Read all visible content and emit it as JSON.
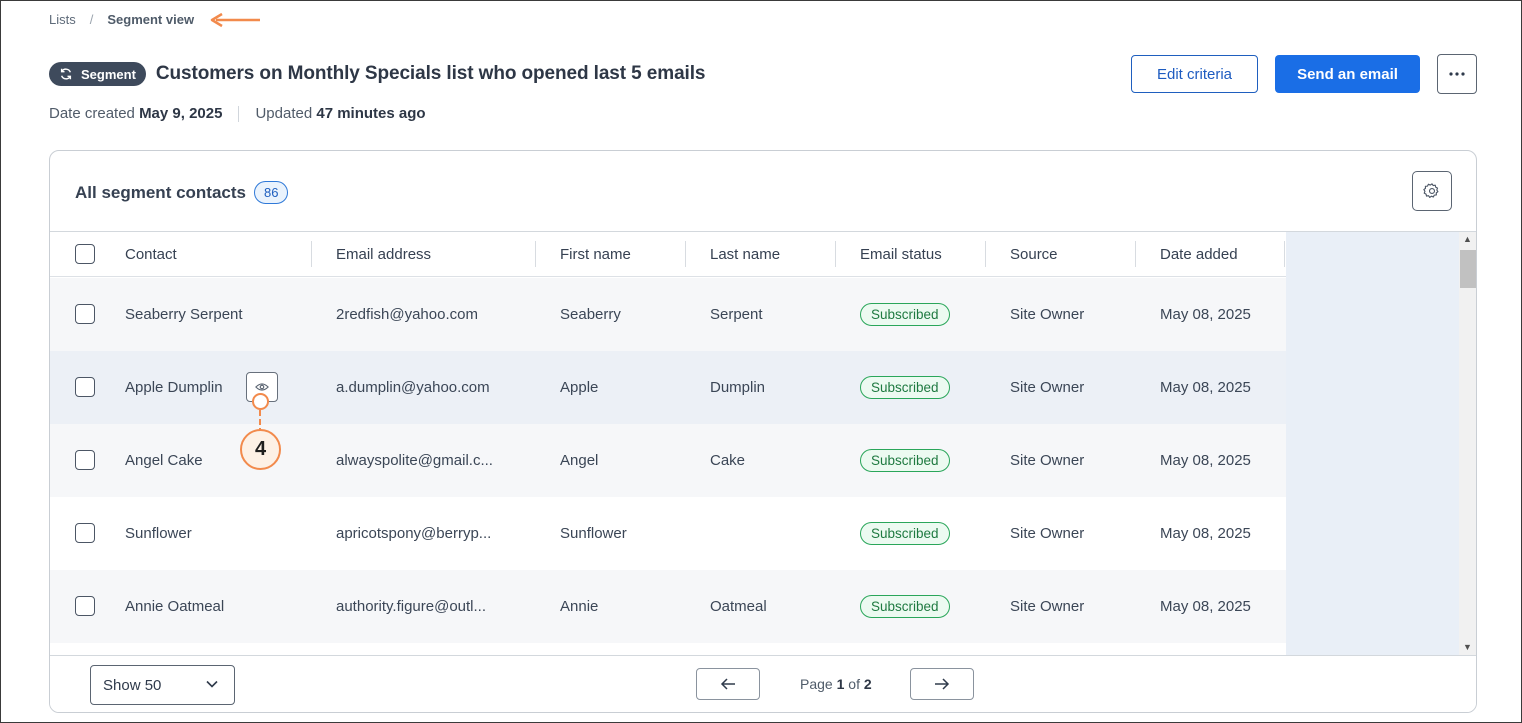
{
  "breadcrumb": {
    "parent": "Lists",
    "separator": "/",
    "current": "Segment view"
  },
  "header": {
    "badge": "Segment",
    "title": "Customers on Monthly Specials list who opened last 5 emails",
    "date_created_label": "Date created",
    "date_created_value": "May 9, 2025",
    "updated_label": "Updated",
    "updated_value": "47 minutes ago",
    "edit_button": "Edit criteria",
    "send_button": "Send an email",
    "more_icon": "more-horizontal-icon"
  },
  "card": {
    "title": "All segment contacts",
    "count": "86",
    "settings_icon": "gear-icon"
  },
  "table": {
    "columns": [
      "Contact",
      "Email address",
      "First name",
      "Last name",
      "Email status",
      "Source",
      "Date added"
    ],
    "rows": [
      {
        "contact": "Seaberry Serpent",
        "email": "2redfish@yahoo.com",
        "first": "Seaberry",
        "last": "Serpent",
        "status": "Subscribed",
        "source": "Site Owner",
        "date": "May 08, 2025"
      },
      {
        "contact": "Apple Dumplin",
        "email": "a.dumplin@yahoo.com",
        "first": "Apple",
        "last": "Dumplin",
        "status": "Subscribed",
        "source": "Site Owner",
        "date": "May 08, 2025"
      },
      {
        "contact": "Angel Cake",
        "email": "alwayspolite@gmail.c...",
        "first": "Angel",
        "last": "Cake",
        "status": "Subscribed",
        "source": "Site Owner",
        "date": "May 08, 2025"
      },
      {
        "contact": "Sunflower",
        "email": "apricotspony@berryp...",
        "first": "Sunflower",
        "last": "",
        "status": "Subscribed",
        "source": "Site Owner",
        "date": "May 08, 2025"
      },
      {
        "contact": "Annie Oatmeal",
        "email": "authority.figure@outl...",
        "first": "Annie",
        "last": "Oatmeal",
        "status": "Subscribed",
        "source": "Site Owner",
        "date": "May 08, 2025"
      }
    ]
  },
  "footer": {
    "show_label": "Show 50",
    "page_prefix": "Page",
    "page_current": "1",
    "page_of": "of",
    "page_total": "2"
  },
  "callout": {
    "number": "4"
  },
  "colors": {
    "accent": "#1a6ee6",
    "callout": "#f28a4c",
    "subscribed": "#2aa65a",
    "badge": "#3e4a5c"
  }
}
